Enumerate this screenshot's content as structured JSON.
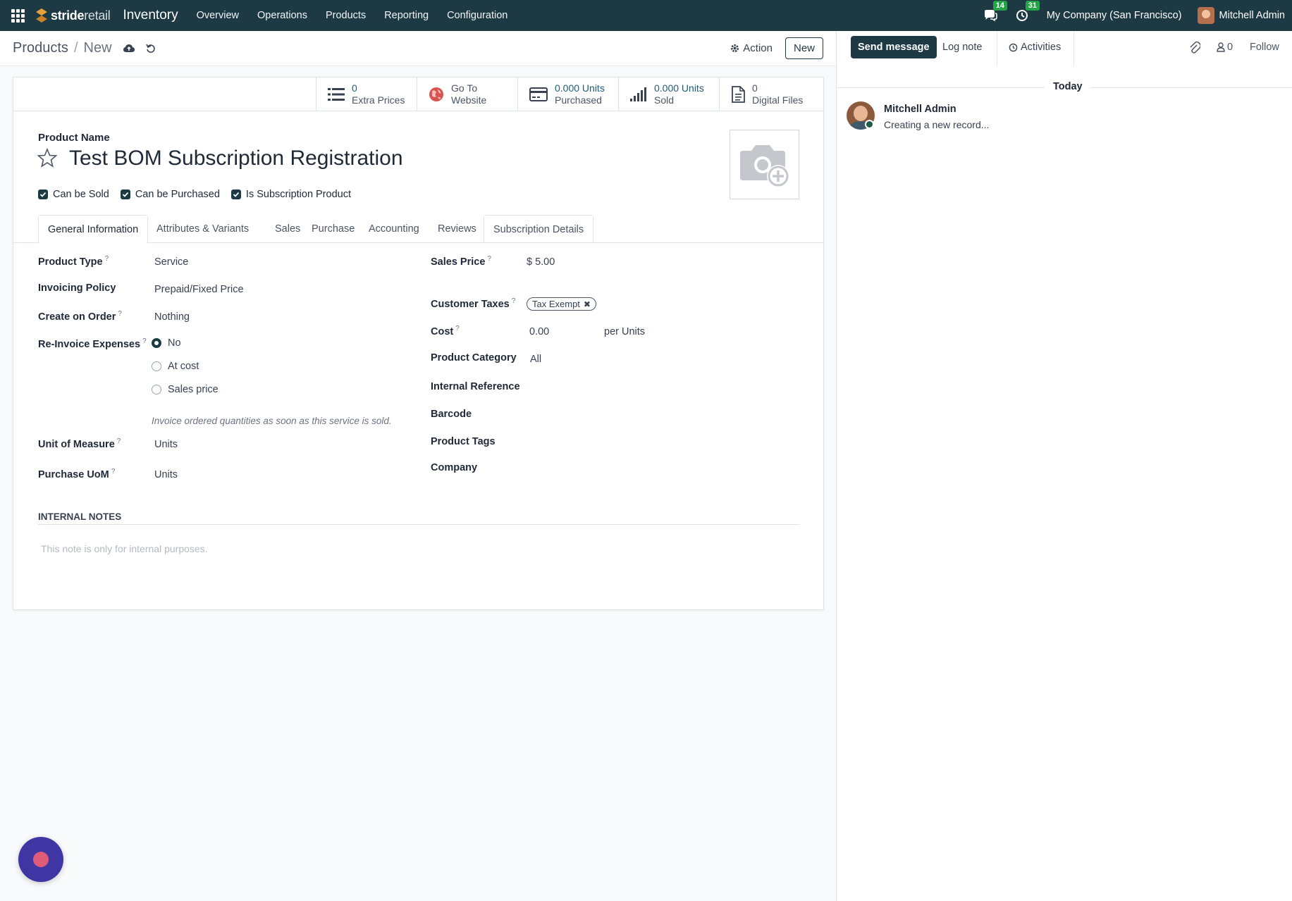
{
  "topnav": {
    "brand_bold": "stride",
    "brand_light": "retail",
    "app": "Inventory",
    "menus": [
      "Overview",
      "Operations",
      "Products",
      "Reporting",
      "Configuration"
    ],
    "messages_count": "14",
    "activities_count": "31",
    "company": "My Company (San Francisco)",
    "user": "Mitchell Admin"
  },
  "control": {
    "breadcrumb_parent": "Products",
    "breadcrumb_sep": "/",
    "breadcrumb_current": "New",
    "action_label": "Action",
    "new_label": "New"
  },
  "smart_buttons": [
    {
      "value": "0",
      "label": "Extra Prices",
      "icon": "list-icon"
    },
    {
      "value": "Go To",
      "label": "Website",
      "icon": "globe-icon"
    },
    {
      "value": "0.000 Units",
      "label": "Purchased",
      "icon": "credit-card-icon"
    },
    {
      "value": "0.000 Units",
      "label": "Sold",
      "icon": "signal-icon"
    },
    {
      "value": "0",
      "label": "Digital Files",
      "icon": "file-icon"
    }
  ],
  "product": {
    "name_label": "Product Name",
    "name": "Test BOM Subscription Registration",
    "checks": [
      "Can be Sold",
      "Can be Purchased",
      "Is Subscription Product"
    ]
  },
  "tabs": [
    "General Information",
    "Attributes & Variants",
    "Sales",
    "Purchase",
    "Accounting",
    "Reviews",
    "Subscription Details"
  ],
  "general": {
    "product_type_label": "Product Type",
    "product_type": "Service",
    "invoicing_policy_label": "Invoicing Policy",
    "invoicing_policy": "Prepaid/Fixed Price",
    "create_on_order_label": "Create on Order",
    "create_on_order": "Nothing",
    "reinvoice_label": "Re-Invoice Expenses",
    "reinvoice_options": [
      "No",
      "At cost",
      "Sales price"
    ],
    "reinvoice_selected": "No",
    "reinvoice_hint": "Invoice ordered quantities as soon as this service is sold.",
    "uom_label": "Unit of Measure",
    "uom": "Units",
    "purchase_uom_label": "Purchase UoM",
    "purchase_uom": "Units",
    "sales_price_label": "Sales Price",
    "sales_price": "$ 5.00",
    "customer_taxes_label": "Customer Taxes",
    "customer_tax_tag": "Tax Exempt",
    "cost_label": "Cost",
    "cost": "0.00",
    "cost_unit": "per Units",
    "category_label": "Product Category",
    "category": "All",
    "internal_ref_label": "Internal Reference",
    "barcode_label": "Barcode",
    "tags_label": "Product Tags",
    "company_label": "Company",
    "help_mark": "?"
  },
  "notes": {
    "title": "INTERNAL NOTES",
    "placeholder": "This note is only for internal purposes."
  },
  "chatter": {
    "send_message": "Send message",
    "log_note": "Log note",
    "activities": "Activities",
    "followers_count": "0",
    "follow": "Follow",
    "date_separator": "Today",
    "message_author": "Mitchell Admin",
    "message_body": "Creating a new record..."
  },
  "colors": {
    "nav_bg": "#1d3a44",
    "badge": "#22a447",
    "primary": "#1d3a44",
    "widget": "#3f35a3"
  }
}
